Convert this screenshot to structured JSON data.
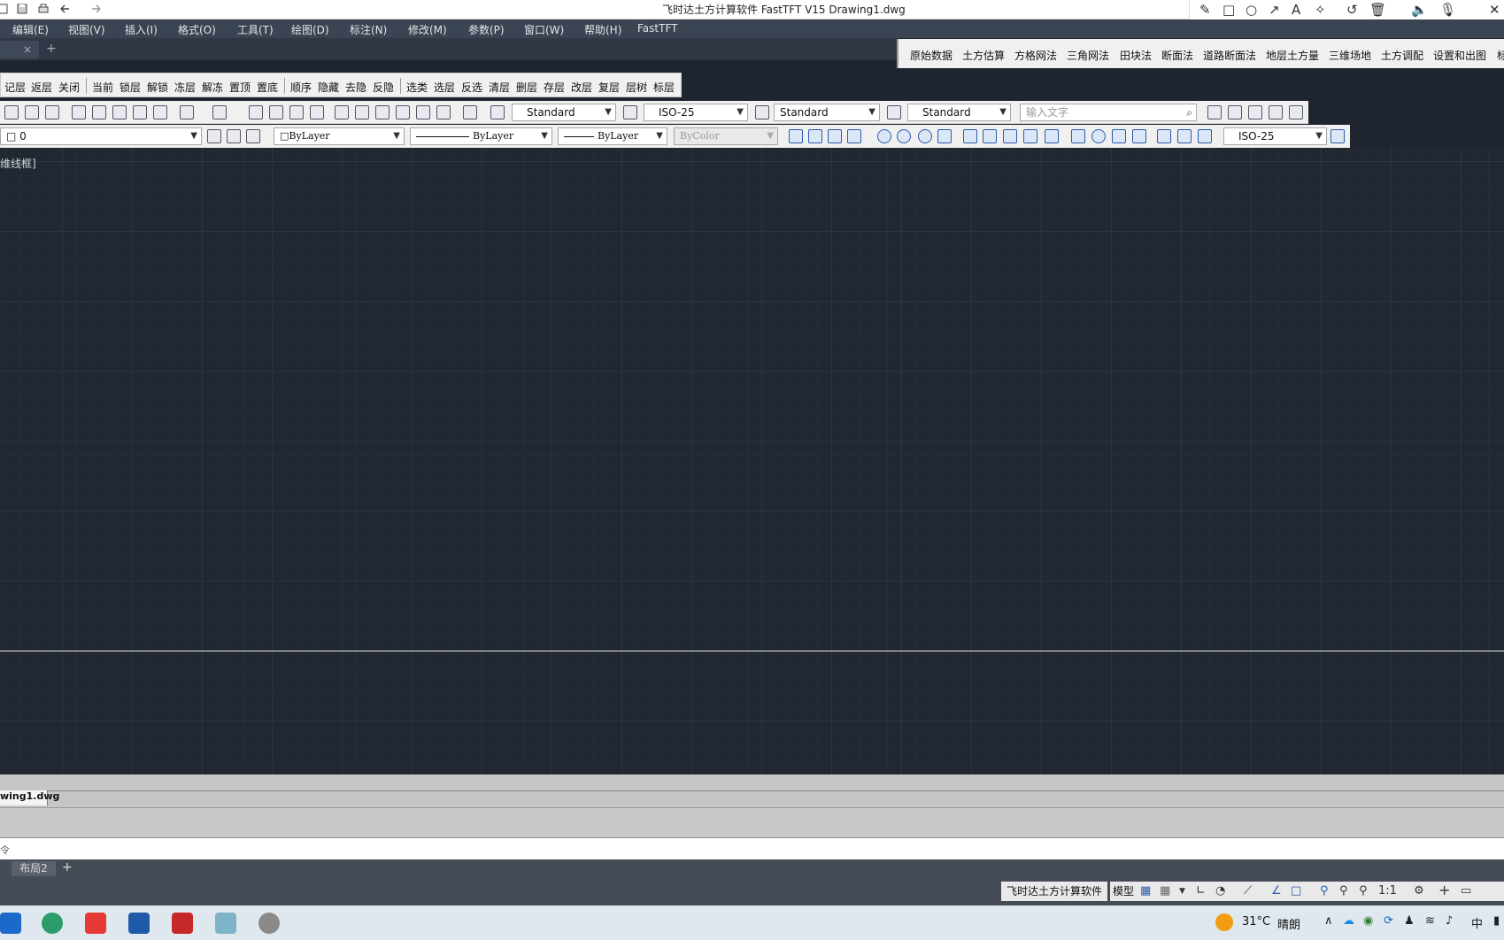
{
  "window": {
    "title": "飞时达土方计算软件 FastTFT V15      Drawing1.dwg"
  },
  "ink_toolbar": [
    "✎",
    "□",
    "○",
    "↗",
    "A",
    "✧",
    "↺",
    "🗑",
    "🔈",
    "🎙",
    "✕"
  ],
  "menu": [
    "编辑(E)",
    "视图(V)",
    "插入(I)",
    "格式(O)",
    "工具(T)",
    "绘图(D)",
    "标注(N)",
    "修改(M)",
    "参数(P)",
    "窗口(W)",
    "帮助(H)",
    "FastTFT"
  ],
  "doc_tab": {
    "close": "×",
    "add": "+"
  },
  "fasttft_toolbar": [
    "原始数据",
    "土方估算",
    "方格网法",
    "三角网法",
    "田块法",
    "断面法",
    "道路断面法",
    "地层土方量",
    "三维场地",
    "土方调配",
    "设置和出图",
    "标"
  ],
  "layer_toolbar": [
    "记层",
    "返层",
    "关闭",
    "当前",
    "锁层",
    "解锁",
    "冻层",
    "解冻",
    "置顶",
    "置底",
    "顺序",
    "隐藏",
    "去隐",
    "反隐",
    "选类",
    "选层",
    "反选",
    "清层",
    "删层",
    "存层",
    "改层",
    "复层",
    "层树",
    "标层"
  ],
  "styles": {
    "text_style": "Standard",
    "dim_style": "ISO-25",
    "table_style": "Standard",
    "mleader_style": "Standard",
    "search_placeholder": "输入文字"
  },
  "properties": {
    "layer": "0",
    "color": "ByLayer",
    "linetype": "ByLayer",
    "lineweight": "ByLayer",
    "plotstyle": "ByColor",
    "dim_style2": "ISO-25"
  },
  "canvas": {
    "view_label": "维线框]"
  },
  "file_tab": "wing1.dwg",
  "command": {
    "prompt": "令"
  },
  "layout_tabs": {
    "tab": "布局2",
    "add": "+"
  },
  "status": {
    "app_name": "飞时达土方计算软件",
    "model": "模型",
    "scale": "1:1"
  },
  "taskbar": {
    "weather": "31°C",
    "condition": "晴朗",
    "ime": "中"
  }
}
